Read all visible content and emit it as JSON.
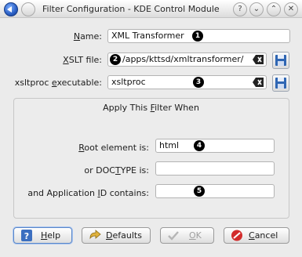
{
  "window": {
    "title": "Filter Configuration - KDE Control Module"
  },
  "titlebar_buttons": [
    {
      "name": "help-button",
      "glyph": "?"
    },
    {
      "name": "minimize-button",
      "glyph": "⌄"
    },
    {
      "name": "maximize-button",
      "glyph": "⌃"
    },
    {
      "name": "close-button",
      "glyph": "✕"
    }
  ],
  "form": {
    "name_label": "Name:",
    "name_value": "XML Transformer",
    "xslt_label": "XSLT file:",
    "xslt_value": "/apps/kttsd/xmltransformer/",
    "xsltproc_label": "xsltproc executable:",
    "xsltproc_value": "xsltproc"
  },
  "group": {
    "title": "Apply This Filter When",
    "root_label": "Root element is:",
    "root_value": "html",
    "doctype_label": "or DOCTYPE is:",
    "doctype_value": "",
    "appid_label": "and Application ID contains:",
    "appid_value": ""
  },
  "callouts": [
    "1",
    "2",
    "3",
    "4",
    "5"
  ],
  "buttons": {
    "help": "Help",
    "defaults": "Defaults",
    "ok": "OK",
    "cancel": "Cancel"
  },
  "colors": {
    "accent": "#5b87c8",
    "cancel_icon": "#d22b2b",
    "folder_icon": "#2f66b3"
  }
}
